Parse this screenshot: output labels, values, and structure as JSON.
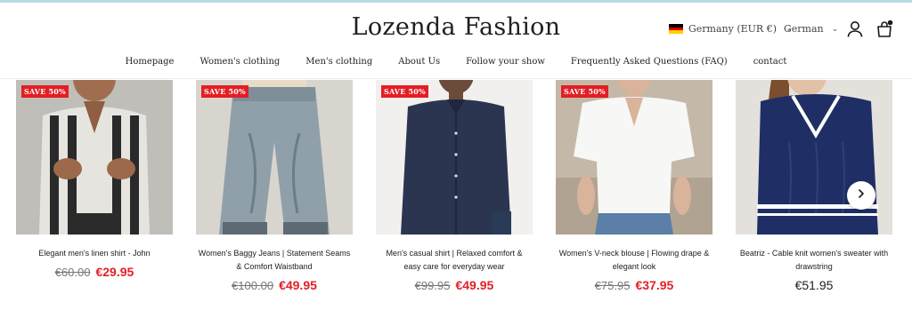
{
  "header": {
    "logo": "Lozenda Fashion",
    "country": "Germany (EUR €)",
    "language": "German"
  },
  "nav": {
    "items": [
      "Homepage",
      "Women's clothing",
      "Men's clothing",
      "About Us",
      "Follow your show",
      "Frequently Asked Questions (FAQ)",
      "contact"
    ]
  },
  "products": [
    {
      "badge": "SAVE 50%",
      "title": "Elegant men's linen shirt - John",
      "old_price": "€60.00",
      "price": "€29.95"
    },
    {
      "badge": "SAVE 50%",
      "title": "Women's Baggy Jeans | Statement Seams & Comfort Waistband",
      "old_price": "€100.00",
      "price": "€49.95"
    },
    {
      "badge": "SAVE 50%",
      "title": "Men's casual shirt | Relaxed comfort & easy care for everyday wear",
      "old_price": "€99.95",
      "price": "€49.95"
    },
    {
      "badge": "SAVE 50%",
      "title": "Women's V-neck blouse | Flowing drape & elegant look",
      "old_price": "€75.95",
      "price": "€37.95"
    },
    {
      "badge": "",
      "title": "Beatriz - Cable knit women's sweater with drawstring",
      "old_price": "",
      "price": "€51.95"
    }
  ],
  "colors": {
    "sale_red": "#e31e24",
    "accent_line": "#b9dbe6"
  },
  "icons": {
    "account": "user-icon",
    "cart": "cart-icon",
    "carousel_next": "chevron-right-icon"
  }
}
